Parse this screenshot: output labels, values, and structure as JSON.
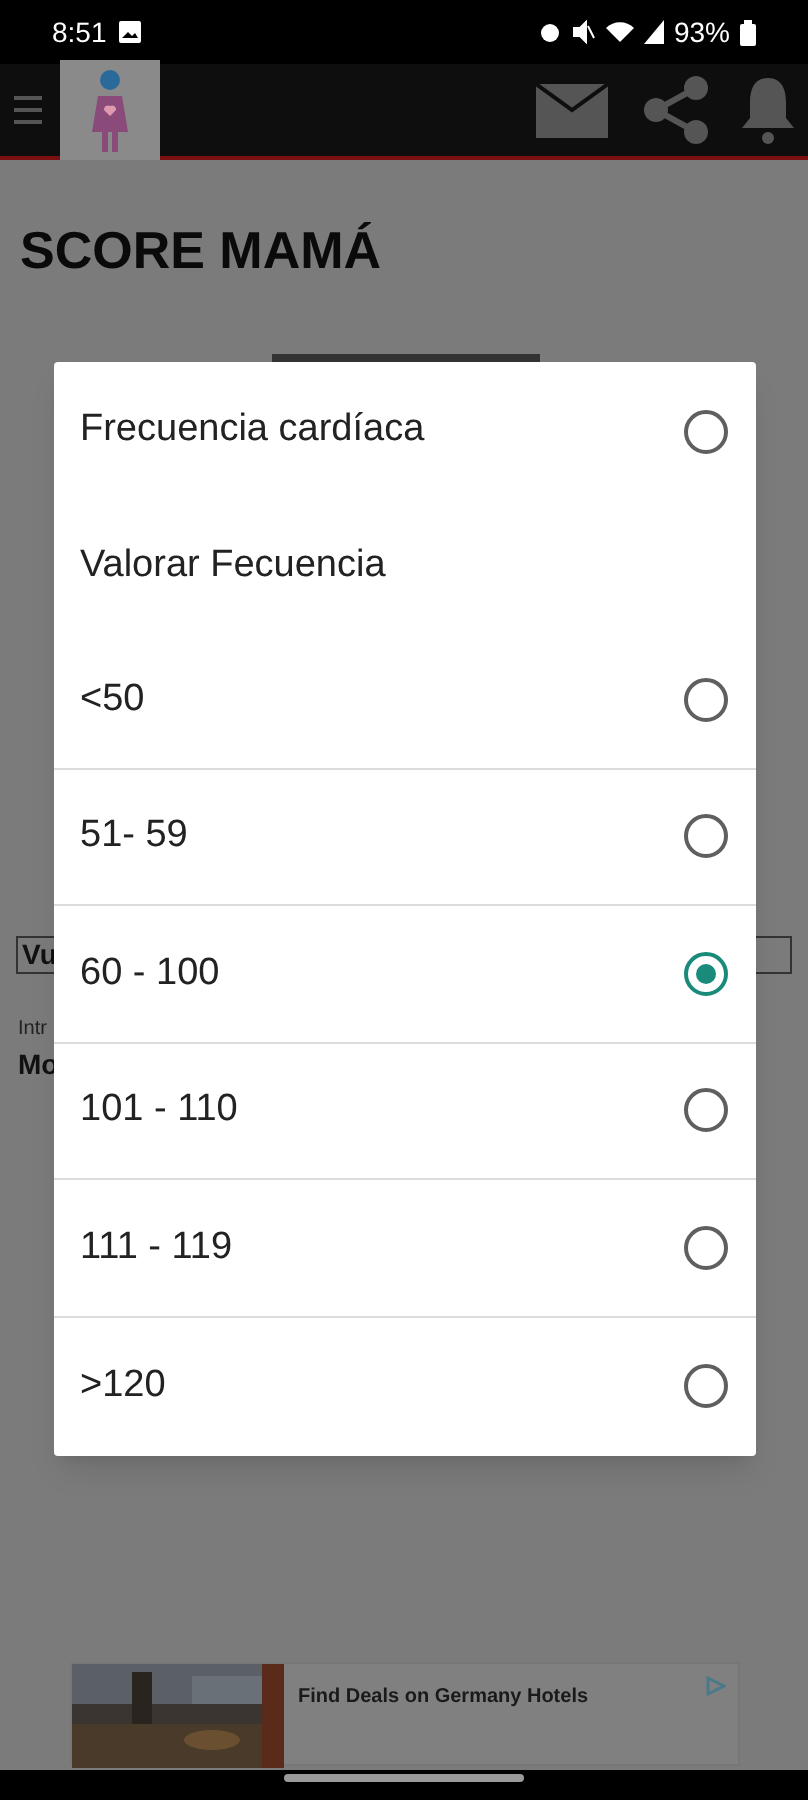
{
  "status_bar": {
    "time": "8:51",
    "battery": "93%"
  },
  "page": {
    "title": "SCORE MAMÁ",
    "field_value": "Vu",
    "caption": "Intr",
    "value": "Mo"
  },
  "dialog": {
    "header": {
      "label": "Frecuencia cardíaca",
      "selected": false
    },
    "subtitle": "Valorar Fecuencia",
    "options": [
      {
        "label": "<50",
        "selected": false
      },
      {
        "label": "51- 59",
        "selected": false
      },
      {
        "label": "60 - 100",
        "selected": true
      },
      {
        "label": "101 - 110",
        "selected": false
      },
      {
        "label": "111 - 119",
        "selected": false
      },
      {
        "label": ">120",
        "selected": false
      }
    ]
  },
  "ad": {
    "headline": "Find Deals on Germany Hotels"
  }
}
